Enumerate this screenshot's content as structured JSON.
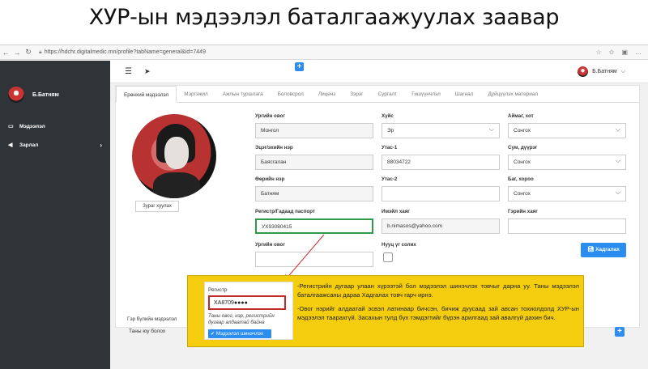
{
  "slide": {
    "title": "ХУР-ын мэдээлэл баталгаажуулах заавар"
  },
  "browser": {
    "url": "https://hdchr.digitalmedic.mn/profile?tabName=general&id=7449"
  },
  "sidebar": {
    "user": "Б.Батням",
    "items": [
      {
        "label": "Мэдээлэл",
        "icon": "monitor-icon"
      },
      {
        "label": "Зарлал",
        "icon": "megaphone-icon"
      }
    ]
  },
  "topbar": {
    "user": "Б.Батням"
  },
  "tabs": [
    "Ерөнхий мэдээлэл",
    "Мэргэжил",
    "Ажлын туршлага",
    "Боловсрол",
    "Лиценз",
    "Зэрэг",
    "Сургалт",
    "Гишүүнчлэл",
    "Шагнал",
    "Дүйцүүлэх материал"
  ],
  "photo_button": "Зураг хуулах",
  "form": {
    "lineage_label": "Ургийн овог",
    "lineage_value": "Монгол",
    "gender_label": "Хүйс",
    "gender_value": "Эр",
    "aimag_label": "Аймаг, хот",
    "aimag_value": "Сонгох",
    "parent_label": "Эцэг/эхийн нэр",
    "parent_value": "Баясгалан",
    "phone1_label": "Утас-1",
    "phone1_value": "88034722",
    "sum_label": "Сум, дүүрэг",
    "sum_value": "Сонгох",
    "name_label": "Өөрийн нэр",
    "name_value": "Батням",
    "phone2_label": "Утас-2",
    "phone2_value": "",
    "bag_label": "Баг, хороо",
    "bag_value": "Сонгох",
    "register_label": "Регистр/Гадаад паспорт",
    "register_value": "УХ93080415",
    "email_label": "Имэйл хаяг",
    "email_value": "b.nimasos@yahoo.com",
    "address_label": "Гэрийн хаяг",
    "address_value": "",
    "surname_label": "Ургийн овог",
    "surname_value": "",
    "password_label": "Нууц үг солих",
    "save_label": "Хадгалах"
  },
  "family": {
    "label": "Гэр бүлийн мэдээлэл",
    "value": "Таны юу болох"
  },
  "callout": {
    "mini_label": "Регистр",
    "mini_value": "ХА8709",
    "mini_mask": "●●●●",
    "mini_error": "Таны овог, нэр, регистрийн дугаар алдаатай байна",
    "mini_button": "Мэдээлэл шинэчлэх",
    "p1": "-Регистрийн дугаар улаан хүрээтэй бол мэдээлэл шинэчлэх товчыг дарна уу. Таны мэдээлэл баталгаажсаны дараа Хадгалах товч гарч ирнэ.",
    "p2": "-Овог нэрийг алдаатай эсвэл латинаар бичсэн, бичиж дуусаад зай авсан тохиолдолд ХУР-ын мэдээлэл таарахгүй. Засахын тулд бүх тэмдэгтийг бүрэн арилгаад зай авалгүй дахин бич."
  },
  "colors": {
    "accent": "#2b8def",
    "sidebar": "#2f3438",
    "callout": "#f4cd0e",
    "highlight": "#2e9a4a",
    "error": "#c32828"
  }
}
